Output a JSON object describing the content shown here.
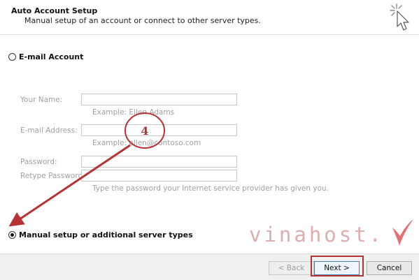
{
  "header": {
    "title": "Auto Account Setup",
    "subtitle": "Manual setup of an account or connect to other server types."
  },
  "options": {
    "email_account": {
      "label": "E-mail Account",
      "selected": false
    },
    "manual_setup": {
      "label": "Manual setup or additional server types",
      "selected": true
    }
  },
  "form": {
    "your_name": {
      "label": "Your Name:",
      "value": "",
      "hint": "Example: Ellen Adams"
    },
    "email_address": {
      "label": "E-mail Address:",
      "value": "",
      "hint": "Example: ellen@contoso.com"
    },
    "password": {
      "label": "Password:",
      "value": ""
    },
    "retype_password": {
      "label": "Retype Password:",
      "value": "",
      "hint": "Type the password your Internet service provider has given you."
    }
  },
  "footer": {
    "back_label": "< Back",
    "next_label": "Next >",
    "cancel_label": "Cancel"
  },
  "annotation": {
    "step_number": "4"
  },
  "watermark": {
    "text": "vinahost."
  },
  "colors": {
    "annotation_red": "#b73232",
    "watermark": "#d79a9a",
    "footer_bg": "#f0f0f0"
  },
  "icons": {
    "wizard": "wizard-cursor-icon",
    "watermark_mark": "checkmark-logo-icon"
  }
}
